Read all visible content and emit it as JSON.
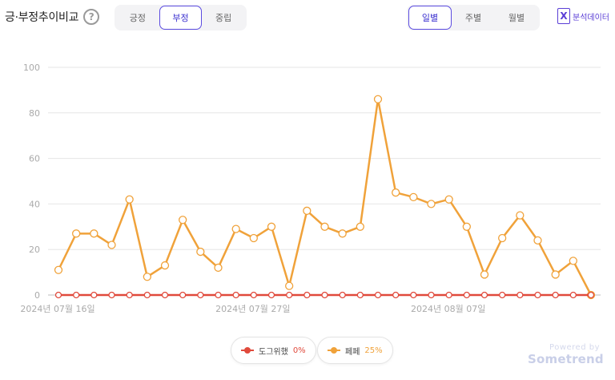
{
  "header": {
    "title": "긍·부정추이비교",
    "help_icon": "?",
    "sentiment_tabs": [
      {
        "label": "긍정",
        "active": false
      },
      {
        "label": "부정",
        "active": true
      },
      {
        "label": "중립",
        "active": false
      }
    ],
    "period_tabs": [
      {
        "label": "일별",
        "active": true
      },
      {
        "label": "주별",
        "active": false
      },
      {
        "label": "월별",
        "active": false
      }
    ],
    "analysis_icon": "X",
    "analysis_label": "분석데이터"
  },
  "chart_data": {
    "type": "line",
    "x": [
      "2024-07-16",
      "2024-07-17",
      "2024-07-18",
      "2024-07-19",
      "2024-07-20",
      "2024-07-21",
      "2024-07-22",
      "2024-07-23",
      "2024-07-24",
      "2024-07-25",
      "2024-07-26",
      "2024-07-27",
      "2024-07-28",
      "2024-07-29",
      "2024-07-30",
      "2024-07-31",
      "2024-08-01",
      "2024-08-02",
      "2024-08-03",
      "2024-08-04",
      "2024-08-05",
      "2024-08-06",
      "2024-08-07",
      "2024-08-08",
      "2024-08-09",
      "2024-08-10",
      "2024-08-11",
      "2024-08-12",
      "2024-08-13",
      "2024-08-14",
      "2024-08-15"
    ],
    "xtick_labels": [
      "2024년 07월 16일",
      "2024년 07월 27일",
      "2024년 08월 07일"
    ],
    "yticks": [
      "0",
      "20",
      "40",
      "60",
      "80",
      "100"
    ],
    "ylim": [
      0,
      100
    ],
    "grid": true,
    "series": [
      {
        "name": "도그위했",
        "percent": "0%",
        "color": "#e04a3c",
        "values": [
          0,
          0,
          0,
          0,
          0,
          0,
          0,
          0,
          0,
          0,
          0,
          0,
          0,
          0,
          0,
          0,
          0,
          0,
          0,
          0,
          0,
          0,
          0,
          0,
          0,
          0,
          0,
          0,
          0,
          0,
          0
        ]
      },
      {
        "name": "페페",
        "percent": "25%",
        "color": "#f0a23a",
        "values": [
          11,
          27,
          27,
          22,
          42,
          8,
          13,
          33,
          19,
          12,
          29,
          25,
          30,
          4,
          37,
          30,
          27,
          30,
          86,
          45,
          43,
          40,
          42,
          30,
          9,
          25,
          35,
          24,
          9,
          15,
          0
        ]
      }
    ]
  },
  "footer": {
    "powered_by": "Powered by",
    "brand": "Sometrend"
  }
}
